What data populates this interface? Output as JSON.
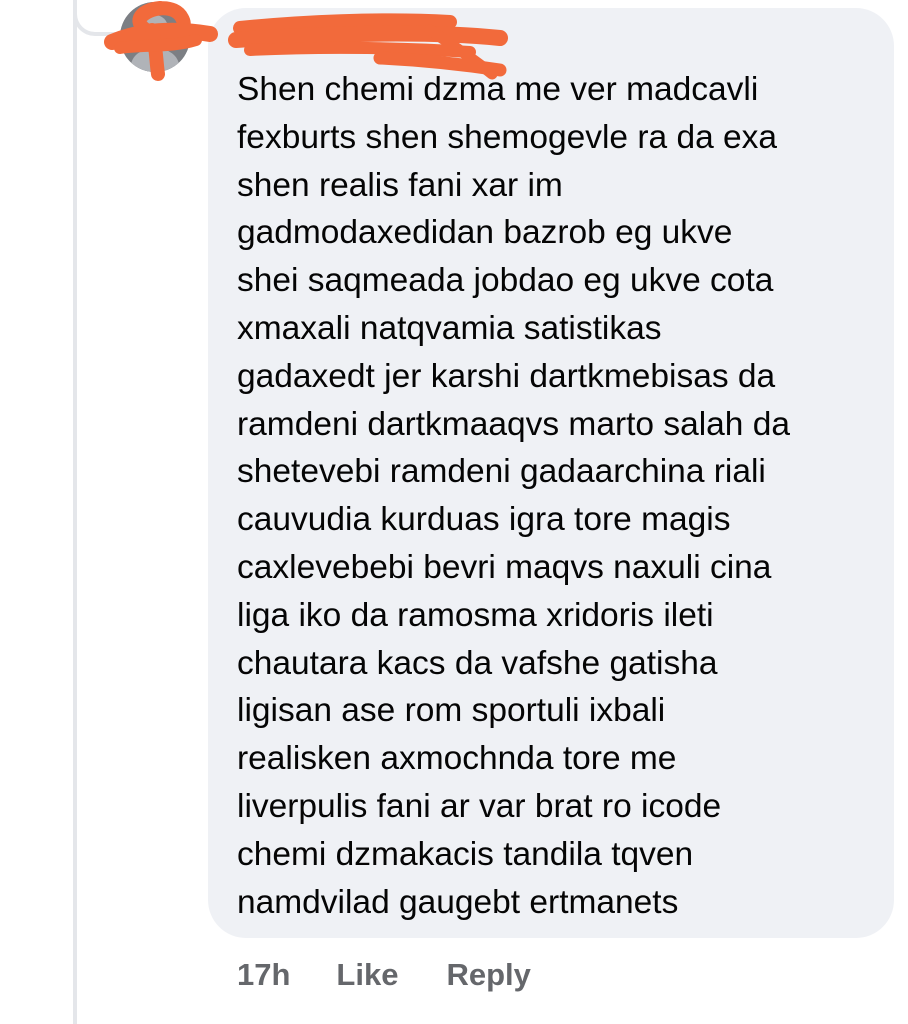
{
  "comment": {
    "author_name": "",
    "text_lines": [
      "Shen chemi dzma me ver madcavli",
      "fexburts shen shemogevle ra da exa",
      "shen realis fani xar im",
      "gadmodaxedidan bazrob eg ukve",
      "shei saqmeada jobdao eg ukve cota",
      "xmaxali natqvamia satistikas",
      "gadaxedt jer karshi dartkmebisas da",
      "ramdeni dartkmaaqvs marto salah da",
      "shetevebi ramdeni gadaarchina riali",
      "cauvudia kurduas igra tore magis",
      "caxlevebebi bevri maqvs naxuli cina",
      "liga iko da ramosma xridoris ileti",
      "chautara kacs da vafshe gatisha",
      "ligisan ase rom sportuli ixbali",
      "realisken axmochnda tore me",
      "liverpulis fani ar var brat ro icode",
      "chemi dzmakacis tandila tqven",
      "namdvilad gaugebt ertmanets"
    ],
    "timestamp": "17h",
    "like_label": "Like",
    "reply_label": "Reply"
  },
  "colors": {
    "bubble_bg": "#eff1f5",
    "text": "#050505",
    "meta_text": "#65676b",
    "redaction": "#f26a3b",
    "thread_line": "#e4e6ea"
  },
  "icons": {
    "avatar": "profile-avatar-redacted",
    "redaction": "orange-scribble"
  }
}
